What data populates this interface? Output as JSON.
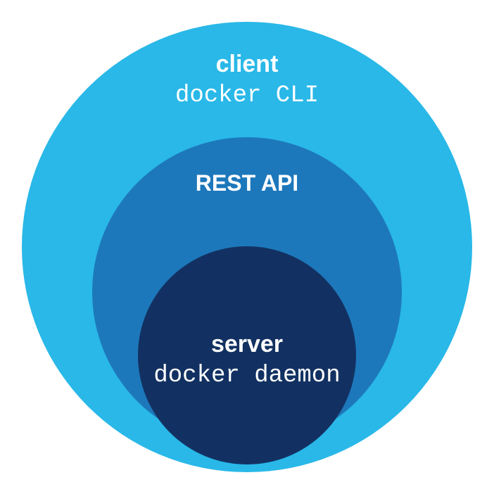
{
  "diagram": {
    "outer": {
      "title": "client",
      "subtitle": "docker CLI",
      "color": "#29B8E8"
    },
    "middle": {
      "title": "REST API",
      "color": "#1D78BB"
    },
    "inner": {
      "title": "server",
      "subtitle": "docker daemon",
      "color": "#123162"
    }
  }
}
